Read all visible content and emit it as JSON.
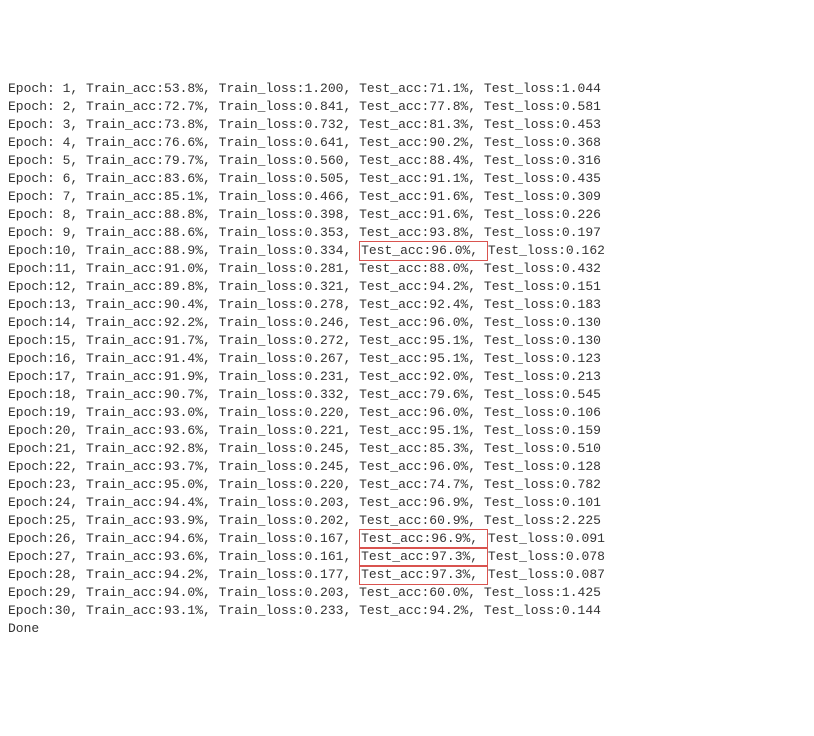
{
  "rows": [
    {
      "epoch": "Epoch: 1, ",
      "train_acc": "Train_acc:53.8%, ",
      "train_loss": "Train_loss:1.200, ",
      "test_acc": "Test_acc:71.1%, ",
      "test_loss": "Test_loss:1.044",
      "hl": false
    },
    {
      "epoch": "Epoch: 2, ",
      "train_acc": "Train_acc:72.7%, ",
      "train_loss": "Train_loss:0.841, ",
      "test_acc": "Test_acc:77.8%, ",
      "test_loss": "Test_loss:0.581",
      "hl": false
    },
    {
      "epoch": "Epoch: 3, ",
      "train_acc": "Train_acc:73.8%, ",
      "train_loss": "Train_loss:0.732, ",
      "test_acc": "Test_acc:81.3%, ",
      "test_loss": "Test_loss:0.453",
      "hl": false
    },
    {
      "epoch": "Epoch: 4, ",
      "train_acc": "Train_acc:76.6%, ",
      "train_loss": "Train_loss:0.641, ",
      "test_acc": "Test_acc:90.2%, ",
      "test_loss": "Test_loss:0.368",
      "hl": false
    },
    {
      "epoch": "Epoch: 5, ",
      "train_acc": "Train_acc:79.7%, ",
      "train_loss": "Train_loss:0.560, ",
      "test_acc": "Test_acc:88.4%, ",
      "test_loss": "Test_loss:0.316",
      "hl": false
    },
    {
      "epoch": "Epoch: 6, ",
      "train_acc": "Train_acc:83.6%, ",
      "train_loss": "Train_loss:0.505, ",
      "test_acc": "Test_acc:91.1%, ",
      "test_loss": "Test_loss:0.435",
      "hl": false
    },
    {
      "epoch": "Epoch: 7, ",
      "train_acc": "Train_acc:85.1%, ",
      "train_loss": "Train_loss:0.466, ",
      "test_acc": "Test_acc:91.6%, ",
      "test_loss": "Test_loss:0.309",
      "hl": false
    },
    {
      "epoch": "Epoch: 8, ",
      "train_acc": "Train_acc:88.8%, ",
      "train_loss": "Train_loss:0.398, ",
      "test_acc": "Test_acc:91.6%, ",
      "test_loss": "Test_loss:0.226",
      "hl": false
    },
    {
      "epoch": "Epoch: 9, ",
      "train_acc": "Train_acc:88.6%, ",
      "train_loss": "Train_loss:0.353, ",
      "test_acc": "Test_acc:93.8%, ",
      "test_loss": "Test_loss:0.197",
      "hl": false
    },
    {
      "epoch": "Epoch:10, ",
      "train_acc": "Train_acc:88.9%, ",
      "train_loss": "Train_loss:0.334, ",
      "test_acc": "Test_acc:96.0%, ",
      "test_loss": "Test_loss:0.162",
      "hl": true
    },
    {
      "epoch": "Epoch:11, ",
      "train_acc": "Train_acc:91.0%, ",
      "train_loss": "Train_loss:0.281, ",
      "test_acc": "Test_acc:88.0%, ",
      "test_loss": "Test_loss:0.432",
      "hl": false
    },
    {
      "epoch": "Epoch:12, ",
      "train_acc": "Train_acc:89.8%, ",
      "train_loss": "Train_loss:0.321, ",
      "test_acc": "Test_acc:94.2%, ",
      "test_loss": "Test_loss:0.151",
      "hl": false
    },
    {
      "epoch": "Epoch:13, ",
      "train_acc": "Train_acc:90.4%, ",
      "train_loss": "Train_loss:0.278, ",
      "test_acc": "Test_acc:92.4%, ",
      "test_loss": "Test_loss:0.183",
      "hl": false
    },
    {
      "epoch": "Epoch:14, ",
      "train_acc": "Train_acc:92.2%, ",
      "train_loss": "Train_loss:0.246, ",
      "test_acc": "Test_acc:96.0%, ",
      "test_loss": "Test_loss:0.130",
      "hl": false
    },
    {
      "epoch": "Epoch:15, ",
      "train_acc": "Train_acc:91.7%, ",
      "train_loss": "Train_loss:0.272, ",
      "test_acc": "Test_acc:95.1%, ",
      "test_loss": "Test_loss:0.130",
      "hl": false
    },
    {
      "epoch": "Epoch:16, ",
      "train_acc": "Train_acc:91.4%, ",
      "train_loss": "Train_loss:0.267, ",
      "test_acc": "Test_acc:95.1%, ",
      "test_loss": "Test_loss:0.123",
      "hl": false
    },
    {
      "epoch": "Epoch:17, ",
      "train_acc": "Train_acc:91.9%, ",
      "train_loss": "Train_loss:0.231, ",
      "test_acc": "Test_acc:92.0%, ",
      "test_loss": "Test_loss:0.213",
      "hl": false
    },
    {
      "epoch": "Epoch:18, ",
      "train_acc": "Train_acc:90.7%, ",
      "train_loss": "Train_loss:0.332, ",
      "test_acc": "Test_acc:79.6%, ",
      "test_loss": "Test_loss:0.545",
      "hl": false
    },
    {
      "epoch": "Epoch:19, ",
      "train_acc": "Train_acc:93.0%, ",
      "train_loss": "Train_loss:0.220, ",
      "test_acc": "Test_acc:96.0%, ",
      "test_loss": "Test_loss:0.106",
      "hl": false
    },
    {
      "epoch": "Epoch:20, ",
      "train_acc": "Train_acc:93.6%, ",
      "train_loss": "Train_loss:0.221, ",
      "test_acc": "Test_acc:95.1%, ",
      "test_loss": "Test_loss:0.159",
      "hl": false
    },
    {
      "epoch": "Epoch:21, ",
      "train_acc": "Train_acc:92.8%, ",
      "train_loss": "Train_loss:0.245, ",
      "test_acc": "Test_acc:85.3%, ",
      "test_loss": "Test_loss:0.510",
      "hl": false
    },
    {
      "epoch": "Epoch:22, ",
      "train_acc": "Train_acc:93.7%, ",
      "train_loss": "Train_loss:0.245, ",
      "test_acc": "Test_acc:96.0%, ",
      "test_loss": "Test_loss:0.128",
      "hl": false
    },
    {
      "epoch": "Epoch:23, ",
      "train_acc": "Train_acc:95.0%, ",
      "train_loss": "Train_loss:0.220, ",
      "test_acc": "Test_acc:74.7%, ",
      "test_loss": "Test_loss:0.782",
      "hl": false
    },
    {
      "epoch": "Epoch:24, ",
      "train_acc": "Train_acc:94.4%, ",
      "train_loss": "Train_loss:0.203, ",
      "test_acc": "Test_acc:96.9%, ",
      "test_loss": "Test_loss:0.101",
      "hl": false
    },
    {
      "epoch": "Epoch:25, ",
      "train_acc": "Train_acc:93.9%, ",
      "train_loss": "Train_loss:0.202, ",
      "test_acc": "Test_acc:60.9%, ",
      "test_loss": "Test_loss:2.225",
      "hl": false
    },
    {
      "epoch": "Epoch:26, ",
      "train_acc": "Train_acc:94.6%, ",
      "train_loss": "Train_loss:0.167, ",
      "test_acc": "Test_acc:96.9%, ",
      "test_loss": "Test_loss:0.091",
      "hl": true
    },
    {
      "epoch": "Epoch:27, ",
      "train_acc": "Train_acc:93.6%, ",
      "train_loss": "Train_loss:0.161, ",
      "test_acc": "Test_acc:97.3%, ",
      "test_loss": "Test_loss:0.078",
      "hl": true
    },
    {
      "epoch": "Epoch:28, ",
      "train_acc": "Train_acc:94.2%, ",
      "train_loss": "Train_loss:0.177, ",
      "test_acc": "Test_acc:97.3%, ",
      "test_loss": "Test_loss:0.087",
      "hl": true
    },
    {
      "epoch": "Epoch:29, ",
      "train_acc": "Train_acc:94.0%, ",
      "train_loss": "Train_loss:0.203, ",
      "test_acc": "Test_acc:60.0%, ",
      "test_loss": "Test_loss:1.425",
      "hl": false
    },
    {
      "epoch": "Epoch:30, ",
      "train_acc": "Train_acc:93.1%, ",
      "train_loss": "Train_loss:0.233, ",
      "test_acc": "Test_acc:94.2%, ",
      "test_loss": "Test_loss:0.144",
      "hl": false
    }
  ],
  "footer": "Done"
}
